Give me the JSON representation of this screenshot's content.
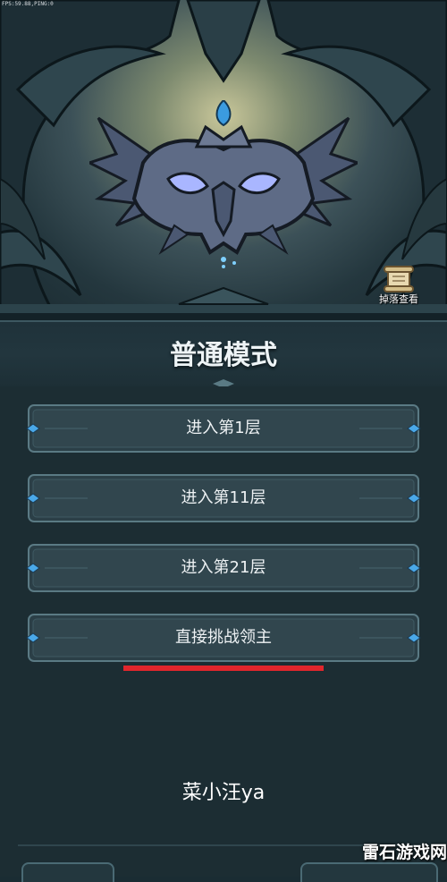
{
  "hud": {
    "fps_text": "FPS:59.88,PING:0"
  },
  "scene": {
    "boss_emblem_icon": "horned-helmet-emblem-icon",
    "loot_button": {
      "icon": "scroll-icon",
      "label": "掉落查看"
    }
  },
  "mode": {
    "title": "普通模式"
  },
  "buttons": [
    {
      "label": "进入第1层"
    },
    {
      "label": "进入第11层"
    },
    {
      "label": "进入第21层"
    },
    {
      "label": "直接挑战领主"
    }
  ],
  "overlay": {
    "username": "菜小汪ya",
    "watermark": "雷石游戏网",
    "highlight_color": "#e1262c"
  },
  "colors": {
    "panel_bg": "#1c2d33",
    "frame": "#5a7a84",
    "gem": "#4aa8e8",
    "text": "#eef2f4"
  }
}
